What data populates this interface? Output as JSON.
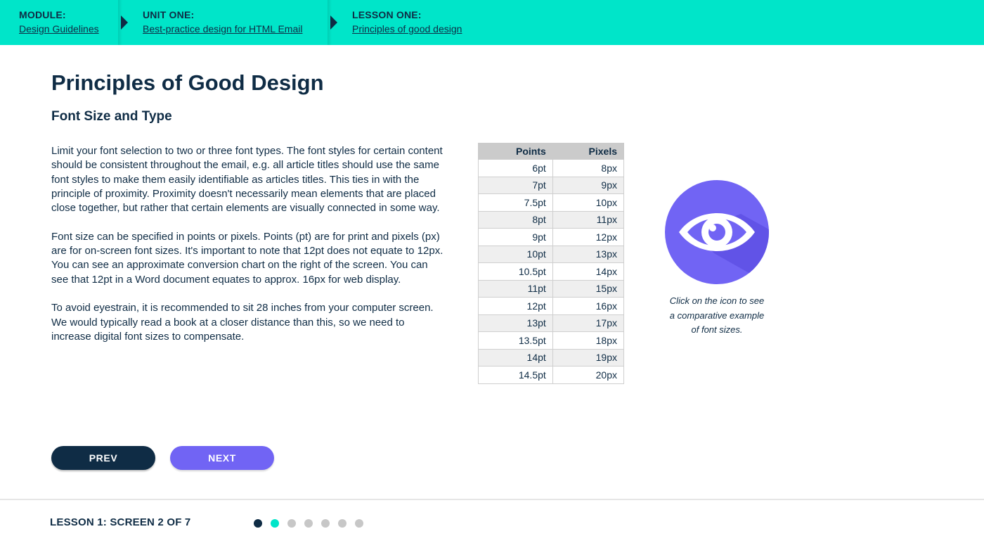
{
  "breadcrumb": [
    {
      "label": "MODULE:",
      "link": "Design Guidelines"
    },
    {
      "label": "UNIT ONE:",
      "link": "Best-practice design for HTML Email"
    },
    {
      "label": "LESSON ONE:",
      "link": "Principles of good design"
    }
  ],
  "page": {
    "title": "Principles of Good Design",
    "subtitle": "Font Size and Type",
    "paragraphs": [
      "Limit your font selection to two or three font types. The font styles for certain content should be consistent throughout the email, e.g. all article titles should use the same font styles to make them easily identifiable as articles titles. This ties in with the principle of proximity. Proximity doesn't necessarily mean elements that are placed close together, but rather that certain elements are visually connected in some way.",
      "Font size can be specified in points or pixels. Points (pt) are for print and pixels (px) are for on-screen font sizes. It's important to note that 12pt does not equate to 12px. You can see an approximate conversion chart on the right of the screen. You can see that 12pt in a Word document equates to approx. 16px for web display.",
      "To avoid eyestrain, it is recommended to sit 28 inches from your computer screen. We would typically read a book at a closer distance than this, so we need to increase digital font sizes to compensate."
    ]
  },
  "table": {
    "headers": [
      "Points",
      "Pixels"
    ],
    "rows": [
      [
        "6pt",
        "8px"
      ],
      [
        "7pt",
        "9px"
      ],
      [
        "7.5pt",
        "10px"
      ],
      [
        "8pt",
        "11px"
      ],
      [
        "9pt",
        "12px"
      ],
      [
        "10pt",
        "13px"
      ],
      [
        "10.5pt",
        "14px"
      ],
      [
        "11pt",
        "15px"
      ],
      [
        "12pt",
        "16px"
      ],
      [
        "13pt",
        "17px"
      ],
      [
        "13.5pt",
        "18px"
      ],
      [
        "14pt",
        "19px"
      ],
      [
        "14.5pt",
        "20px"
      ]
    ]
  },
  "icon": {
    "name": "eye-icon",
    "caption_lines": [
      "Click on the icon to see",
      "a comparative example",
      "of font sizes."
    ]
  },
  "nav": {
    "prev_label": "PREV",
    "next_label": "NEXT"
  },
  "footer": {
    "progress_text": "LESSON 1: SCREEN 2 OF 7",
    "current_screen": 2,
    "total_screens": 7
  },
  "colors": {
    "accent_teal": "#00e5c9",
    "navy": "#0f2c45",
    "purple": "#7164f4"
  }
}
